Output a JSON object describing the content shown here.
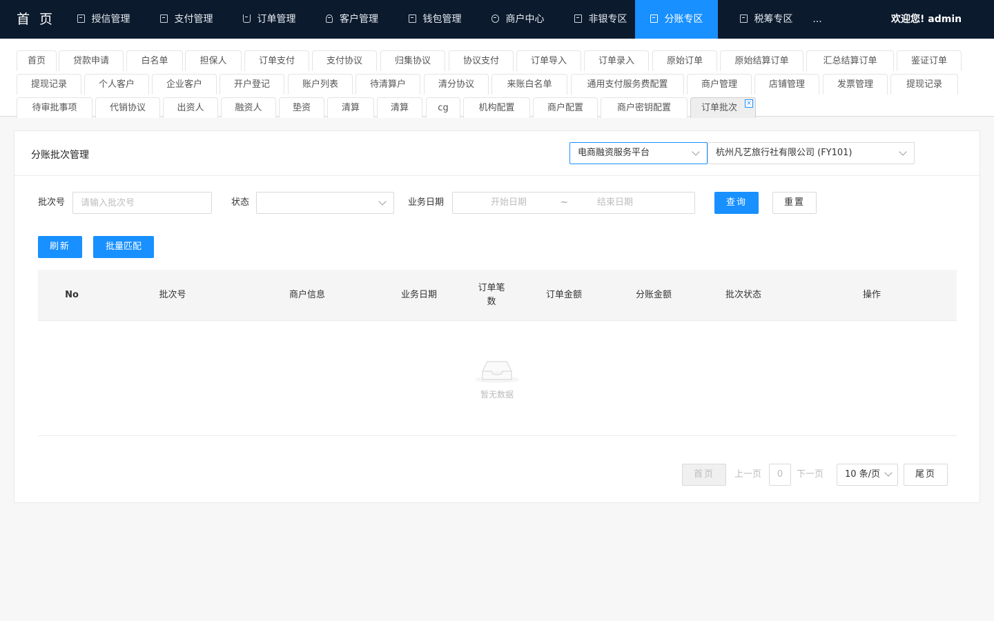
{
  "topnav": {
    "brand": "首 页",
    "items": [
      {
        "label": "授信管理",
        "icon": "doc-icon"
      },
      {
        "label": "支付管理",
        "icon": "shield-icon"
      },
      {
        "label": "订单管理",
        "icon": "cart-icon"
      },
      {
        "label": "客户管理",
        "icon": "user-icon"
      },
      {
        "label": "钱包管理",
        "icon": "doc-icon"
      },
      {
        "label": "商户中心",
        "icon": "clock-icon"
      },
      {
        "label": "非银专区",
        "icon": "shield-icon"
      },
      {
        "label": "分账专区",
        "icon": "shield-icon",
        "active": true
      },
      {
        "label": "税筹专区",
        "icon": "shield-icon"
      },
      {
        "label": "..."
      }
    ],
    "welcome": "欢迎您! admin"
  },
  "tabs": {
    "row1": [
      "首页",
      "贷款申请",
      "白名单",
      "担保人",
      "订单支付",
      "支付协议",
      "归集协议",
      "协议支付",
      "订单导入",
      "订单录入",
      "原始订单",
      "原始结算订单",
      "汇总结算订单",
      "鉴证订单"
    ],
    "row2": [
      "提现记录",
      "个人客户",
      "企业客户",
      "开户登记",
      "账户列表",
      "待清算户",
      "清分协议",
      "来账白名单",
      "通用支付服务费配置",
      "商户管理",
      "店铺管理",
      "发票管理",
      "提现记录"
    ],
    "row3": [
      "待审批事项",
      "代销协议",
      "出资人",
      "融资人",
      "垫资",
      "清算",
      "清算",
      "cg",
      "机构配置",
      "商户配置",
      "商户密钥配置",
      "订单批次"
    ],
    "active_close": "×"
  },
  "card": {
    "title": "分账批次管理",
    "platform_select": "电商融资服务平台",
    "merchant_select": "杭州凡艺旅行社有限公司 (FY101)"
  },
  "filters": {
    "batch_label": "批次号",
    "batch_placeholder": "请输入批次号",
    "status_label": "状态",
    "status_value": "",
    "date_label": "业务日期",
    "date_start": "开始日期",
    "date_sep": "~",
    "date_end": "结束日期",
    "query_btn": "查询",
    "reset_btn": "重置"
  },
  "actions": {
    "refresh_btn": "刷新",
    "batch_match_btn": "批量匹配"
  },
  "table": {
    "columns": [
      "No",
      "批次号",
      "商户信息",
      "业务日期",
      "订单笔数",
      "订单金额",
      "分账金额",
      "批次状态",
      "操作"
    ],
    "empty_text": "暂无数据"
  },
  "pagination": {
    "first": "首页",
    "prev": "上一页",
    "page": "0",
    "next": "下一页",
    "page_size": "10 条/页",
    "last": "尾页"
  }
}
